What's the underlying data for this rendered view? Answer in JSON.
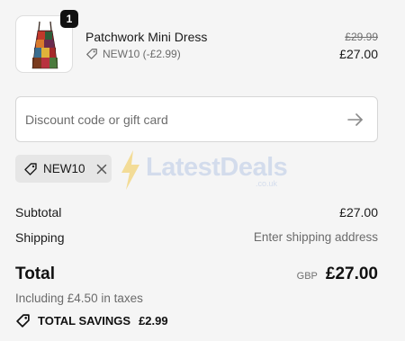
{
  "cart": {
    "item": {
      "quantity": "1",
      "name": "Patchwork Mini Dress",
      "discount_code_label": "NEW10 (-£2.99)",
      "original_price": "£29.99",
      "price": "£27.00"
    }
  },
  "discount": {
    "placeholder": "Discount code or gift card",
    "value": "",
    "applied_code": "NEW10"
  },
  "watermark": {
    "brand": "LatestDeals",
    "domain": ".co.uk"
  },
  "summary": {
    "subtotal_label": "Subtotal",
    "subtotal_value": "£27.00",
    "shipping_label": "Shipping",
    "shipping_value": "Enter shipping address",
    "total_label": "Total",
    "currency": "GBP",
    "total_value": "£27.00",
    "taxes_note": "Including £4.50 in taxes",
    "savings_label": "TOTAL SAVINGS",
    "savings_value": "£2.99"
  },
  "icons": {
    "tag": "tag-icon",
    "arrow": "arrow-right-icon",
    "close": "close-icon",
    "bolt": "lightning-bolt-icon"
  },
  "colors": {
    "background": "#f5f5f5",
    "text": "#1a1a1a",
    "muted": "#6b6b6b",
    "chip": "#e6e6e6",
    "watermark": "#b9c9e6"
  }
}
